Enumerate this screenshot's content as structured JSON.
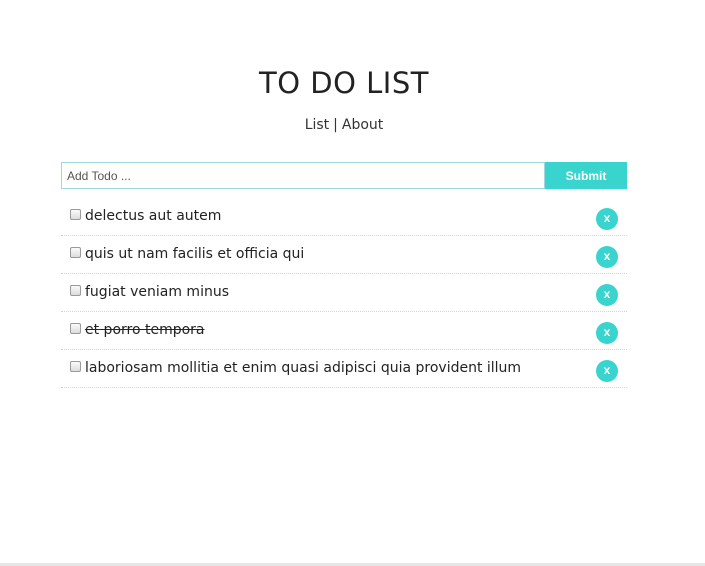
{
  "header": {
    "title": "TO DO LIST"
  },
  "nav": {
    "links": [
      "List",
      "About"
    ],
    "separator": "|"
  },
  "form": {
    "input_value": "",
    "input_placeholder": "Add Todo ...",
    "submit_label": "Submit"
  },
  "todos": [
    {
      "title": "delectus aut autem",
      "completed": false,
      "delete_label": "x"
    },
    {
      "title": "quis ut nam facilis et officia qui",
      "completed": false,
      "delete_label": "x"
    },
    {
      "title": "fugiat veniam minus",
      "completed": false,
      "delete_label": "x"
    },
    {
      "title": "et porro tempora",
      "completed": true,
      "delete_label": "x"
    },
    {
      "title": "laboriosam mollitia et enim quasi adipisci quia provident illum",
      "completed": false,
      "delete_label": "x"
    }
  ],
  "colors": {
    "accent": "#3ad4cf",
    "input_border": "#9fd8de",
    "text": "#222222"
  }
}
